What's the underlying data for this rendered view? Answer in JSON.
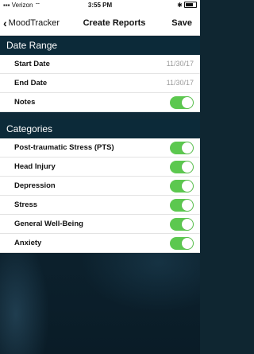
{
  "status_bar": {
    "carrier": "Verizon",
    "time": "3:55 PM"
  },
  "nav": {
    "back_label": "MoodTracker",
    "title": "Create Reports",
    "save_label": "Save"
  },
  "date_range": {
    "header": "Date Range",
    "start_label": "Start Date",
    "start_value": "11/30/17",
    "end_label": "End Date",
    "end_value": "11/30/17",
    "notes_label": "Notes",
    "notes_on": true
  },
  "categories": {
    "header": "Categories",
    "items": [
      {
        "label": "Post-traumatic Stress (PTS)",
        "on": true
      },
      {
        "label": "Head Injury",
        "on": true
      },
      {
        "label": "Depression",
        "on": true
      },
      {
        "label": "Stress",
        "on": true
      },
      {
        "label": "General Well-Being",
        "on": true
      },
      {
        "label": "Anxiety",
        "on": true
      }
    ]
  },
  "colors": {
    "toggle_on": "#5cc84f",
    "section_bg": "#0c2a39"
  }
}
